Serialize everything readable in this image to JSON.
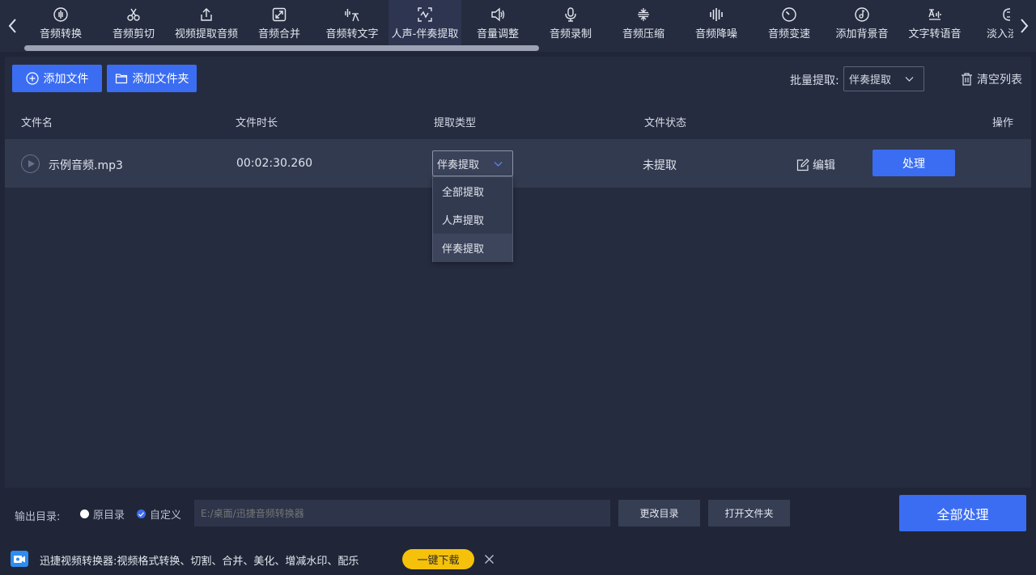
{
  "toolbar": {
    "tools": [
      {
        "label": "音频转换",
        "icon": "waveform-circle-icon"
      },
      {
        "label": "音频剪切",
        "icon": "scissors-icon"
      },
      {
        "label": "视频提取音频",
        "icon": "upload-icon"
      },
      {
        "label": "音频合并",
        "icon": "merge-arrows-icon"
      },
      {
        "label": "音频转文字",
        "icon": "speech-to-text-icon"
      },
      {
        "label": "人声-伴奏提取",
        "icon": "vocal-extract-icon"
      },
      {
        "label": "音量调整",
        "icon": "speaker-icon"
      },
      {
        "label": "音频录制",
        "icon": "microphone-icon"
      },
      {
        "label": "音频压缩",
        "icon": "compress-icon"
      },
      {
        "label": "音频降噪",
        "icon": "noise-reduction-icon"
      },
      {
        "label": "音频变速",
        "icon": "speed-dial-icon"
      },
      {
        "label": "添加背景音",
        "icon": "music-disc-icon"
      },
      {
        "label": "文字转语音",
        "icon": "text-to-speech-icon"
      },
      {
        "label": "淡入淡出",
        "icon": "fade-icon"
      }
    ],
    "active_index": 5
  },
  "actions": {
    "add_file": "添加文件",
    "add_folder": "添加文件夹",
    "batch_label": "批量提取:",
    "batch_value": "伴奏提取",
    "clear_list": "清空列表"
  },
  "table": {
    "headers": {
      "name": "文件名",
      "duration": "文件时长",
      "type": "提取类型",
      "status": "文件状态",
      "ops": "操作"
    },
    "rows": [
      {
        "name": "示例音频.mp3",
        "duration": "00:02:30.260",
        "type": "伴奏提取",
        "status": "未提取",
        "edit": "编辑",
        "process": "处理"
      }
    ]
  },
  "dropdown": {
    "options": [
      "全部提取",
      "人声提取",
      "伴奏提取"
    ],
    "selected_index": 2
  },
  "footer": {
    "output_label": "输出目录:",
    "radio_original": "原目录",
    "radio_custom": "自定义",
    "path_placeholder": "E:/桌面/迅捷音频转换器",
    "change_dir": "更改目录",
    "open_folder": "打开文件夹",
    "process_all": "全部处理"
  },
  "ad": {
    "text": "迅捷视频转换器:视频格式转换、切割、合并、美化、增减水印、配乐",
    "download": "一键下载"
  },
  "colors": {
    "background": "#202638",
    "panel": "#262c40",
    "row": "#323a50",
    "accent": "#3b6df2",
    "download_yellow": "#f5c10a"
  }
}
